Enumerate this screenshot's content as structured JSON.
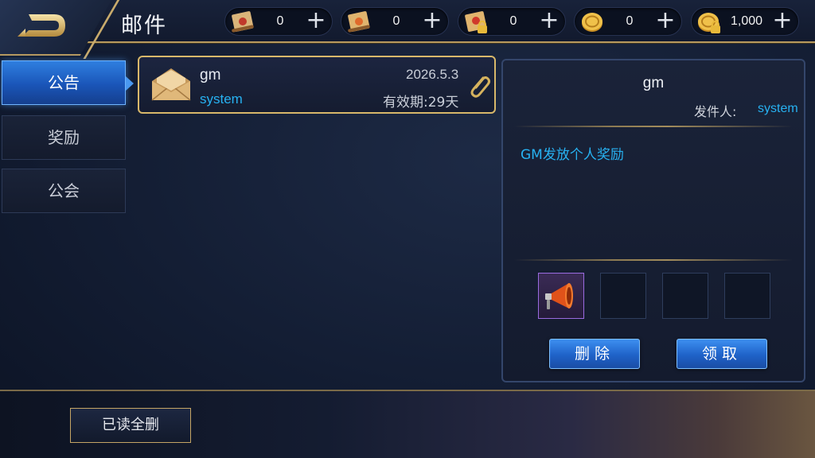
{
  "header": {
    "title": "邮件"
  },
  "resources": [
    {
      "icon": "red-scroll-icon",
      "value": "0"
    },
    {
      "icon": "gold-scroll-icon",
      "value": "0"
    },
    {
      "icon": "locked-scroll-icon",
      "value": "0"
    },
    {
      "icon": "gold-coin-icon",
      "value": "0"
    },
    {
      "icon": "locked-coin-icon",
      "value": "1,000"
    }
  ],
  "tabs": [
    {
      "label": "公告",
      "active": true
    },
    {
      "label": "奖励",
      "active": false
    },
    {
      "label": "公会",
      "active": false
    }
  ],
  "mail_list": [
    {
      "sender": "gm",
      "from": "system",
      "date": "2026.5.3",
      "expire": "有效期:29天",
      "has_attachment": true
    }
  ],
  "detail": {
    "title": "gm",
    "sender_label": "发件人:",
    "sender_value": "system",
    "body": "GM发放个人奖励",
    "attachments": [
      "megaphone-icon",
      "",
      "",
      ""
    ],
    "delete_label": "删除",
    "claim_label": "领取"
  },
  "footer": {
    "delete_read_label": "已读全删"
  },
  "colors": {
    "accent_blue": "#27b2f2",
    "gold_border": "#d8b86a",
    "button_blue": "#1f62c8"
  }
}
